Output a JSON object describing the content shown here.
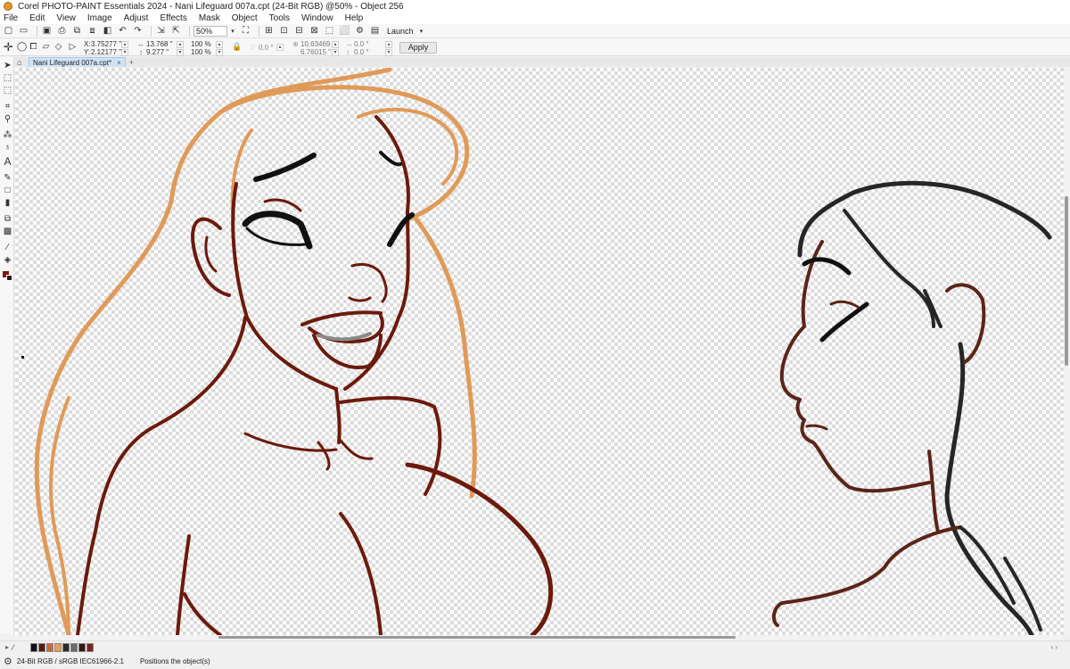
{
  "window": {
    "title": "Corel PHOTO-PAINT Essentials 2024 - Nani Lifeguard 007a.cpt (24-Bit RGB) @50% - Object 256"
  },
  "menu": {
    "items": [
      "File",
      "Edit",
      "View",
      "Image",
      "Adjust",
      "Effects",
      "Mask",
      "Object",
      "Tools",
      "Window",
      "Help"
    ]
  },
  "toolbar": {
    "zoom_value": "50%",
    "launch_label": "Launch"
  },
  "property_bar": {
    "x_label": "X:",
    "x_value": "3.75277 \"",
    "y_label": "Y:",
    "y_value": "2.12177 \"",
    "width_value": "13.768 \"",
    "height_value": "9.277 \"",
    "scale_w": "100 %",
    "scale_h": "100 %",
    "rotate_value": "0.0 °",
    "center_x": "10.63469 \"",
    "center_y": "6.76015 \"",
    "skew_h": "0.0 °",
    "skew_v": "0.0 °",
    "apply_label": "Apply"
  },
  "tabs": {
    "doc_tab_label": "Nani Lifeguard 007a.cpt*",
    "add_tab_label": "+"
  },
  "palette": {
    "colors": [
      "#111111",
      "#5a1a0e",
      "#c96a3a",
      "#e7a158",
      "#2a2a2a",
      "#6b6b6b",
      "#3b1410",
      "#7a2416"
    ]
  },
  "status": {
    "color_profile": "24-Bit RGB / sRGB IEC61966-2.1",
    "message": "Positions the object(s)"
  },
  "art": {
    "hair_color": "#e09a58",
    "line_color": "#6b1a0c",
    "ink_color": "#111111",
    "dark_hair_color": "#262626",
    "brown_line_color": "#5b2418"
  }
}
